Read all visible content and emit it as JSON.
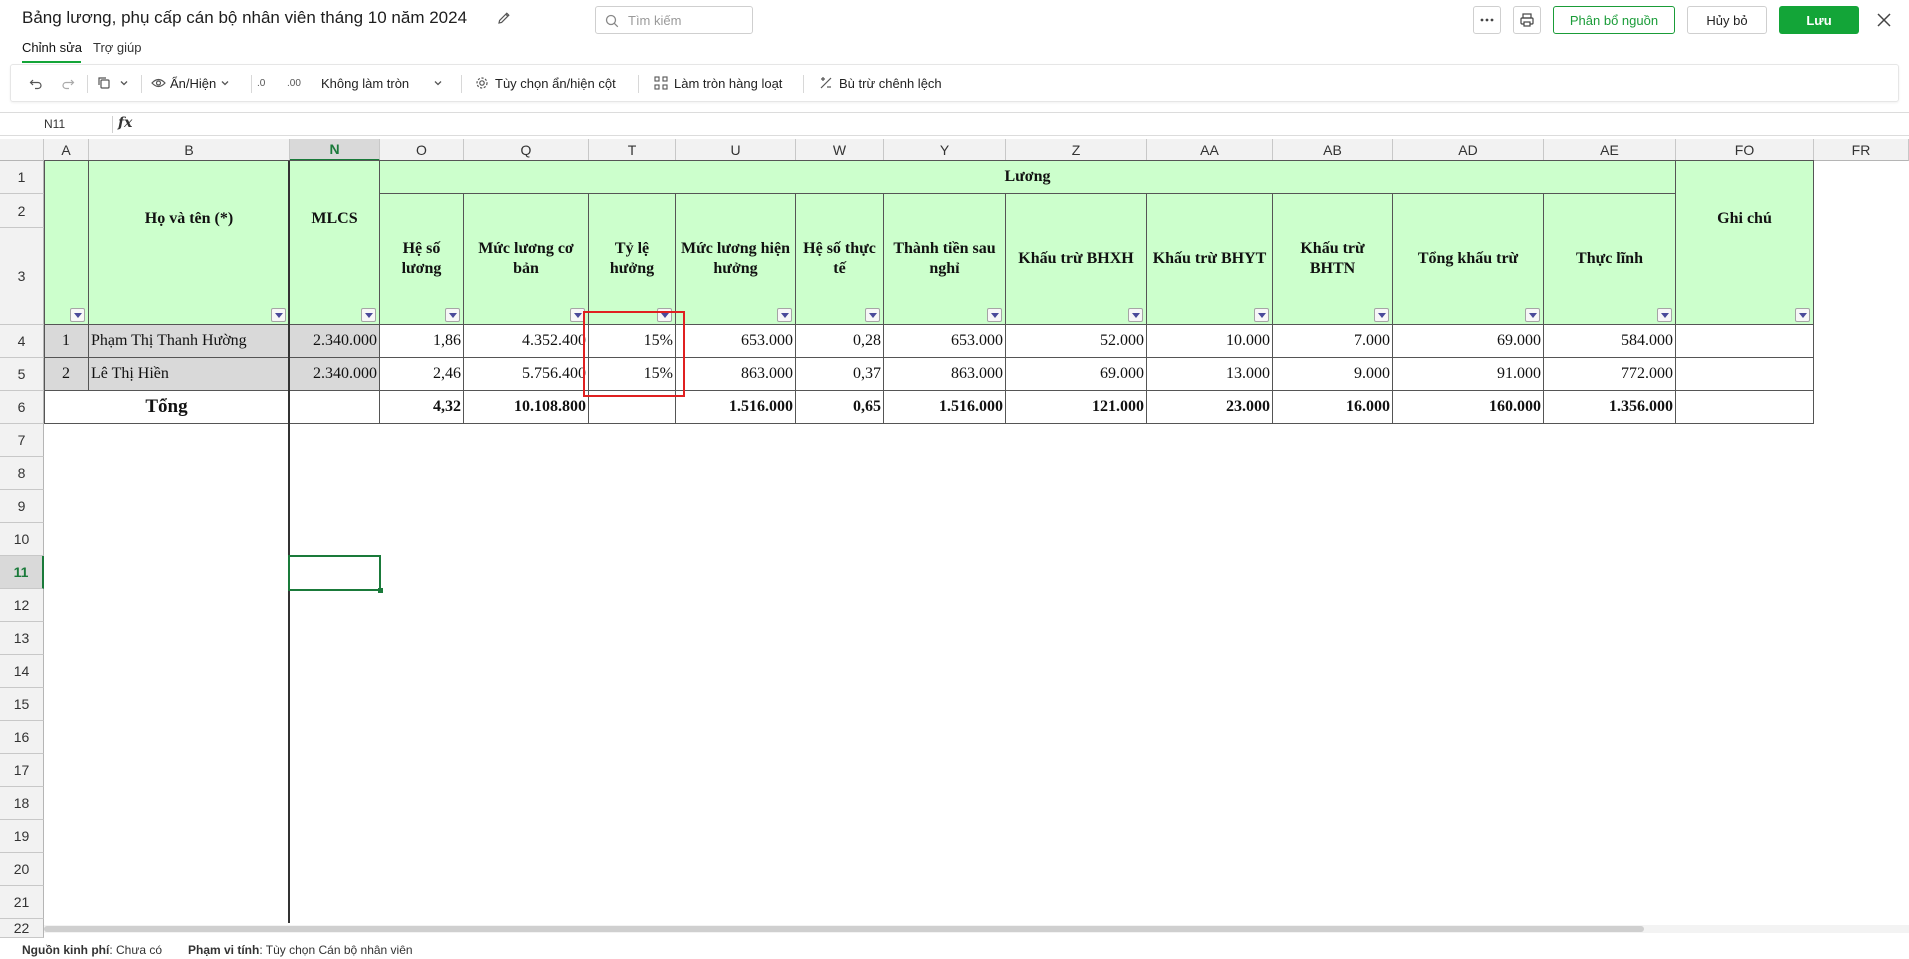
{
  "title": "Bảng lương, phụ cấp cán bộ nhân viên tháng 10 năm 2024",
  "search": {
    "placeholder": "Tìm kiếm"
  },
  "header_buttons": {
    "allocate": "Phân bổ nguồn",
    "cancel": "Hủy bỏ",
    "save": "Lưu"
  },
  "menu": {
    "edit": "Chỉnh sửa",
    "help": "Trợ giúp"
  },
  "toolbar": {
    "show_hide": "Ẩn/Hiện",
    "decrease_decimal": ".0",
    "increase_decimal": ".00",
    "rounding": "Không làm tròn",
    "column_options": "Tùy chọn ẩn/hiện cột",
    "bulk_round": "Làm tròn hàng loạt",
    "offset_diff": "Bù trừ chênh lệch"
  },
  "formula_bar": {
    "cell_ref": "N11",
    "fx": "fx",
    "value": ""
  },
  "columns": [
    "A",
    "B",
    "N",
    "O",
    "Q",
    "T",
    "U",
    "W",
    "Y",
    "Z",
    "AA",
    "AB",
    "AD",
    "AE",
    "FO",
    "FR"
  ],
  "selected_column": "N",
  "rows": [
    "1",
    "2",
    "3",
    "4",
    "5",
    "6",
    "7",
    "8",
    "9",
    "10",
    "11",
    "12",
    "13",
    "14",
    "15",
    "16",
    "17",
    "18",
    "19",
    "20",
    "21",
    "22"
  ],
  "selected_row": "11",
  "headers": {
    "name": "Họ và tên (*)",
    "mlcs": "MLCS",
    "group": "Lương",
    "coefficient": "Hệ số lương",
    "base_salary": "Mức lương cơ bản",
    "ratio": "Tỷ lệ hưởng",
    "current_salary": "Mức lương hiện hưởng",
    "actual_coef": "Hệ số thực tế",
    "after_leave": "Thành tiền sau nghỉ",
    "bhxh": "Khấu trừ BHXH",
    "bhyt": "Khấu trừ BHYT",
    "bhtn": "Khấu trừ BHTN",
    "total_deduction": "Tổng khấu trừ",
    "net": "Thực lĩnh",
    "note": "Ghi chú"
  },
  "employees": [
    {
      "stt": "1",
      "name": "Phạm Thị Thanh  Hường",
      "mlcs": "2.340.000",
      "coefficient": "1,86",
      "base_salary": "4.352.400",
      "ratio": "15%",
      "current_salary": "653.000",
      "actual_coef": "0,28",
      "after_leave": "653.000",
      "bhxh": "52.000",
      "bhyt": "10.000",
      "bhtn": "7.000",
      "total_deduction": "69.000",
      "net": "584.000",
      "note": ""
    },
    {
      "stt": "2",
      "name": "Lê Thị Hiền",
      "mlcs": "2.340.000",
      "coefficient": "2,46",
      "base_salary": "5.756.400",
      "ratio": "15%",
      "current_salary": "863.000",
      "actual_coef": "0,37",
      "after_leave": "863.000",
      "bhxh": "69.000",
      "bhyt": "13.000",
      "bhtn": "9.000",
      "total_deduction": "91.000",
      "net": "772.000",
      "note": ""
    }
  ],
  "totals": {
    "label": "Tổng",
    "coefficient": "4,32",
    "base_salary": "10.108.800",
    "current_salary": "1.516.000",
    "actual_coef": "0,65",
    "after_leave": "1.516.000",
    "bhxh": "121.000",
    "bhyt": "23.000",
    "bhtn": "16.000",
    "total_deduction": "160.000",
    "net": "1.356.000"
  },
  "status": {
    "fund_label": "Nguồn kinh phí",
    "fund_value": ": Chưa có",
    "scope_label": "Phạm vi tính",
    "scope_value": ": Tùy chọn Cán bộ nhân viên"
  },
  "colors": {
    "accent": "#13a538",
    "header_fill": "#ccffcc",
    "highlight": "#e02020"
  }
}
